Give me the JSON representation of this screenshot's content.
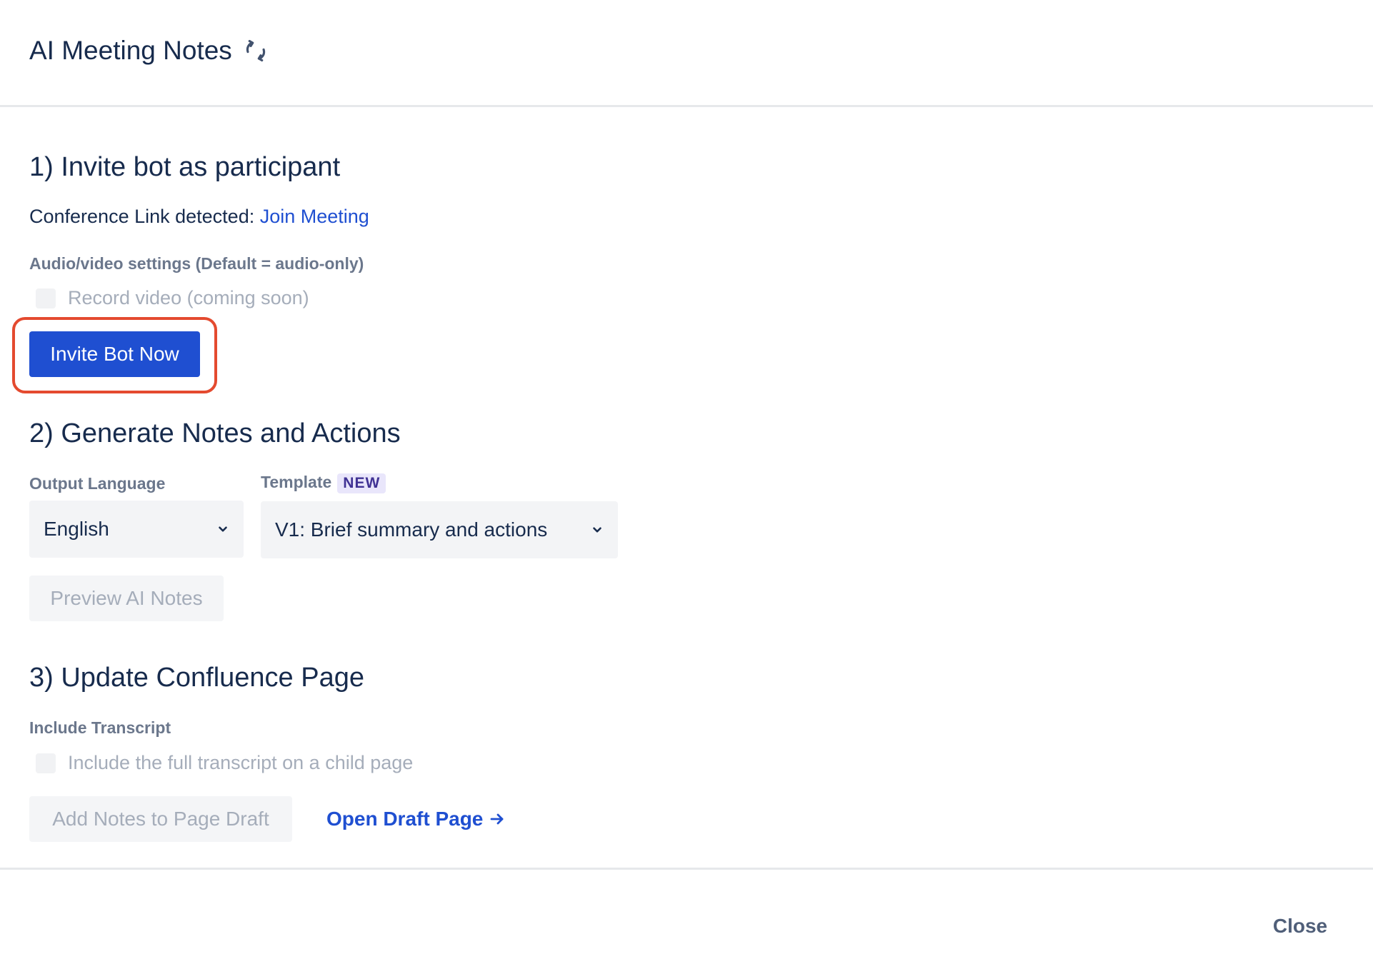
{
  "header": {
    "title": "AI Meeting Notes",
    "refresh_icon": "refresh-icon"
  },
  "section1": {
    "heading": "1) Invite bot as participant",
    "conference_prefix": "Conference Link detected:",
    "conference_link": "Join Meeting",
    "av_settings_label": "Audio/video settings (Default = audio-only)",
    "record_video_label": "Record video (coming soon)",
    "record_video_checked": false,
    "invite_button": "Invite Bot Now"
  },
  "section2": {
    "heading": "2) Generate Notes and Actions",
    "language_label": "Output Language",
    "language_value": "English",
    "template_label": "Template",
    "template_badge": "NEW",
    "template_value": "V1: Brief summary and actions",
    "preview_button": "Preview AI Notes"
  },
  "section3": {
    "heading": "3) Update Confluence Page",
    "transcript_label": "Include Transcript",
    "transcript_checkbox_label": "Include the full transcript on a child page",
    "transcript_checked": false,
    "add_notes_button": "Add Notes to Page Draft",
    "open_draft_link": "Open Draft Page"
  },
  "footer": {
    "close_button": "Close"
  },
  "colors": {
    "primary": "#1f4fd1",
    "highlight": "#e44a2f",
    "text": "#172b4d",
    "muted": "#6b778c",
    "disabled": "#a5adba",
    "badge_bg": "#e9e6fb",
    "badge_text": "#403294"
  }
}
